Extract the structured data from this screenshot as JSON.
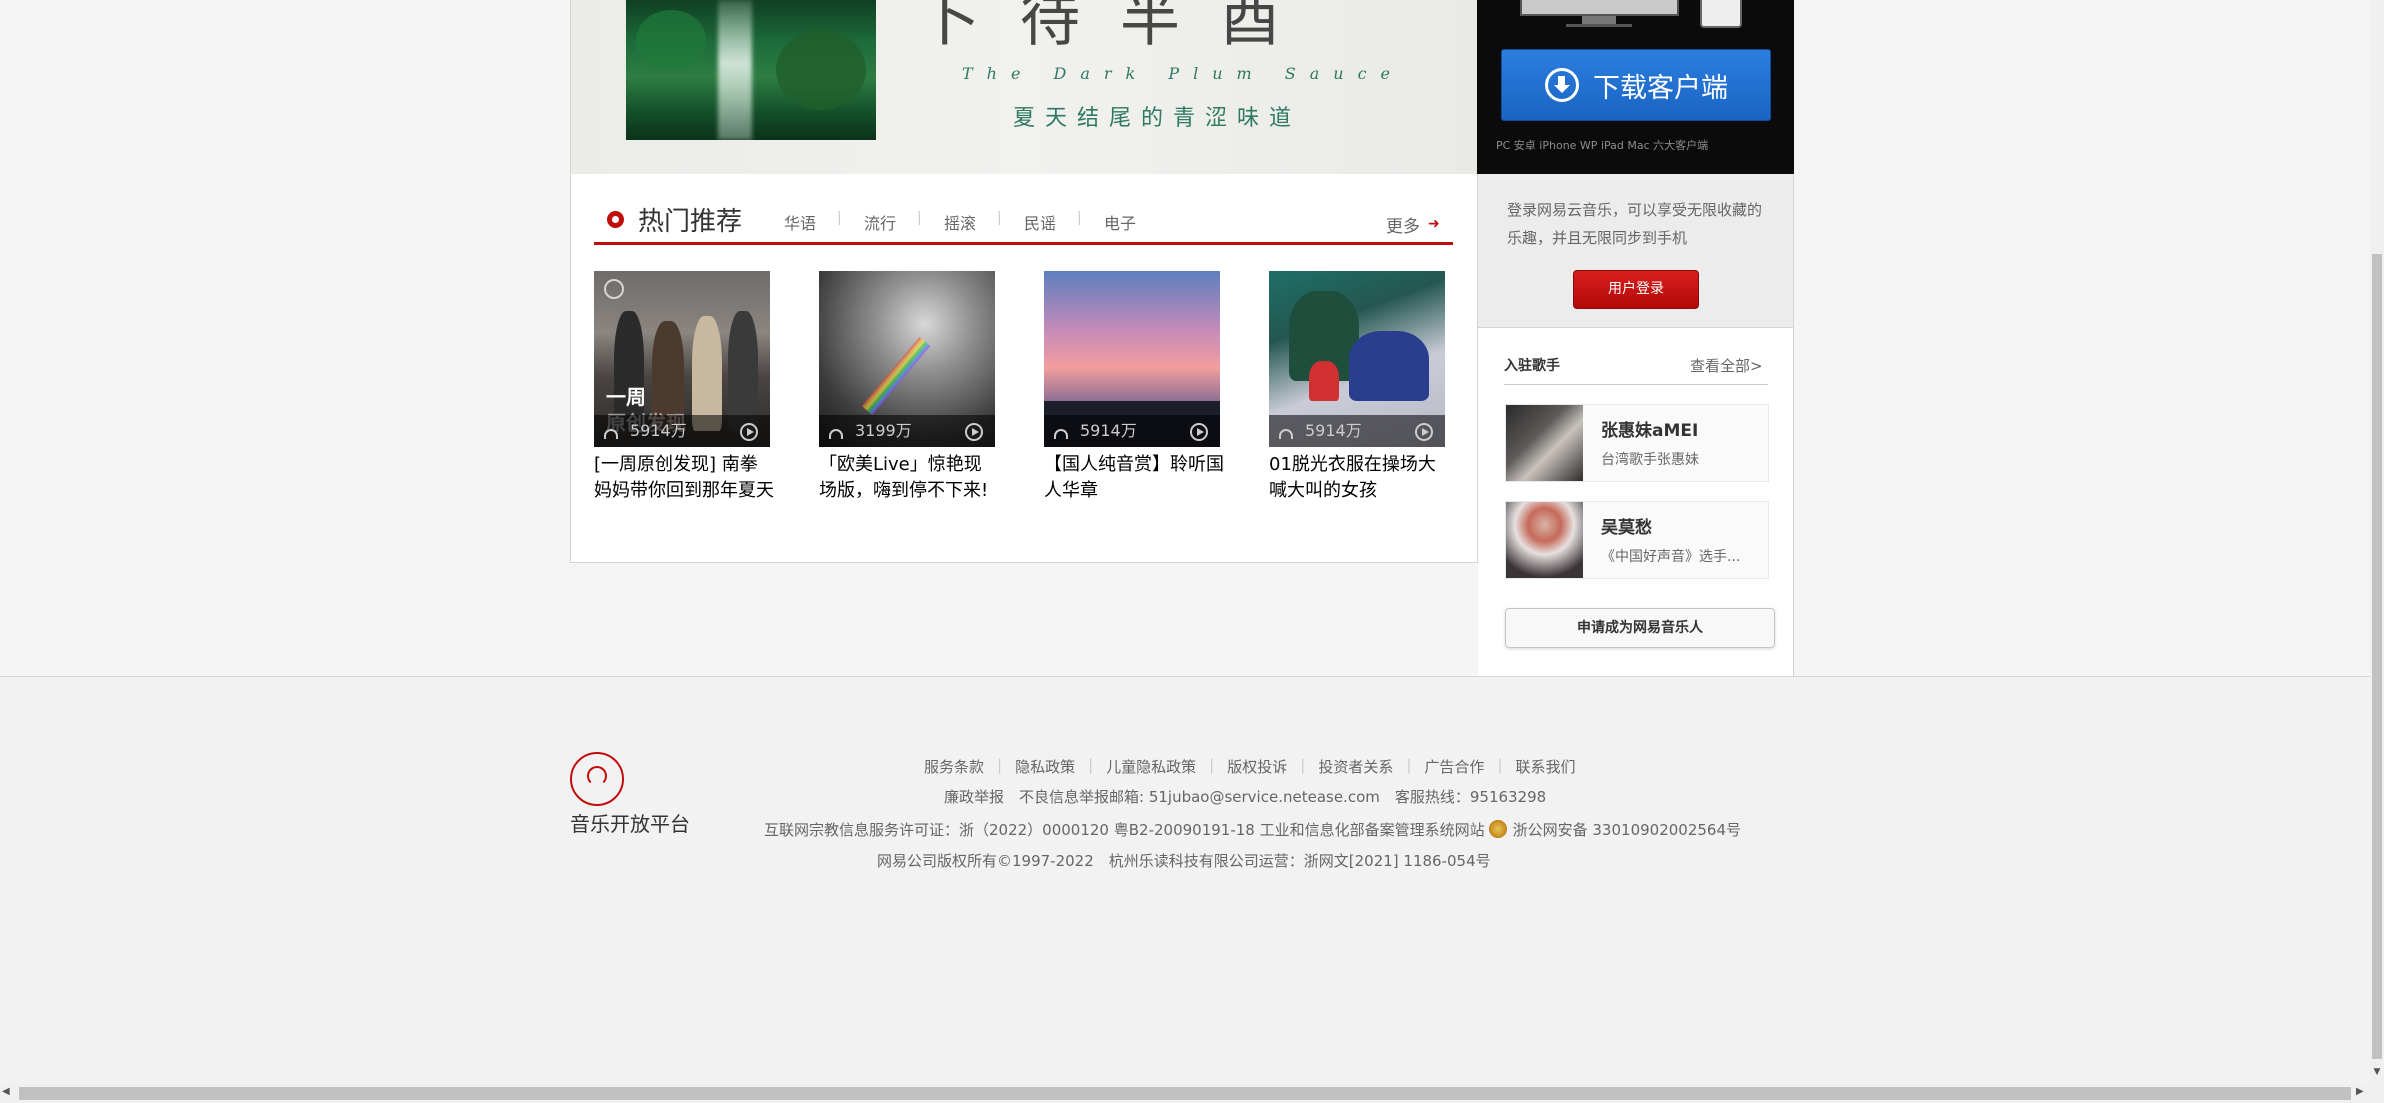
{
  "banner": {
    "calligraphy": "卜待半酉",
    "subtitle": "The Dark Plum Sauce",
    "slogan": "夏天结尾的青涩味道"
  },
  "download": {
    "button_label": "下载客户端",
    "platforms": "PC 安卓 iPhone WP iPad Mac 六大客户端"
  },
  "hot": {
    "title": "热门推荐",
    "tabs": [
      "华语",
      "流行",
      "摇滚",
      "民谣",
      "电子"
    ],
    "more_label": "更多",
    "cards": [
      {
        "count": "5914万",
        "title": "[一周原创发现] 南拳妈妈带你回到那年夏天",
        "overlay1": "一周",
        "overlay2": "原创发现"
      },
      {
        "count": "3199万",
        "title": "「欧美Live」惊艳现场版，嗨到停不下来!"
      },
      {
        "count": "5914万",
        "title": "【国人纯音赏】聆听国人华章"
      },
      {
        "count": "5914万",
        "title": "01脱光衣服在操场大喊大叫的女孩"
      }
    ]
  },
  "sidebar": {
    "login_text": "登录网易云音乐，可以享受无限收藏的乐趣，并且无限同步到手机",
    "login_button": "用户登录",
    "singers_title": "入驻歌手",
    "singers_all": "查看全部>",
    "singers": [
      {
        "name": "张惠妹aMEI",
        "desc": "台湾歌手张惠妹"
      },
      {
        "name": "吴莫愁",
        "desc": "《中国好声音》选手..."
      }
    ],
    "apply_button": "申请成为网易音乐人"
  },
  "footer": {
    "platform_name": "音乐开放平台",
    "links": [
      "服务条款",
      "隐私政策",
      "儿童隐私政策",
      "版权投诉",
      "投资者关系",
      "广告合作",
      "联系我们"
    ],
    "row2": "廉政举报　不良信息举报邮箱: 51jubao@service.netease.com　客服热线：95163298",
    "row3a": "互联网宗教信息服务许可证：浙（2022）0000120 粤B2-20090191-18 工业和信息化部备案管理系统网站",
    "row3b": "浙公网安备 33010902002564号",
    "row4": "网易公司版权所有©1997-2022　杭州乐读科技有限公司运营：浙网文[2021] 1186-054号"
  },
  "colors": {
    "accent_red": "#c20c0c",
    "download_blue": "#1f6fd1"
  }
}
